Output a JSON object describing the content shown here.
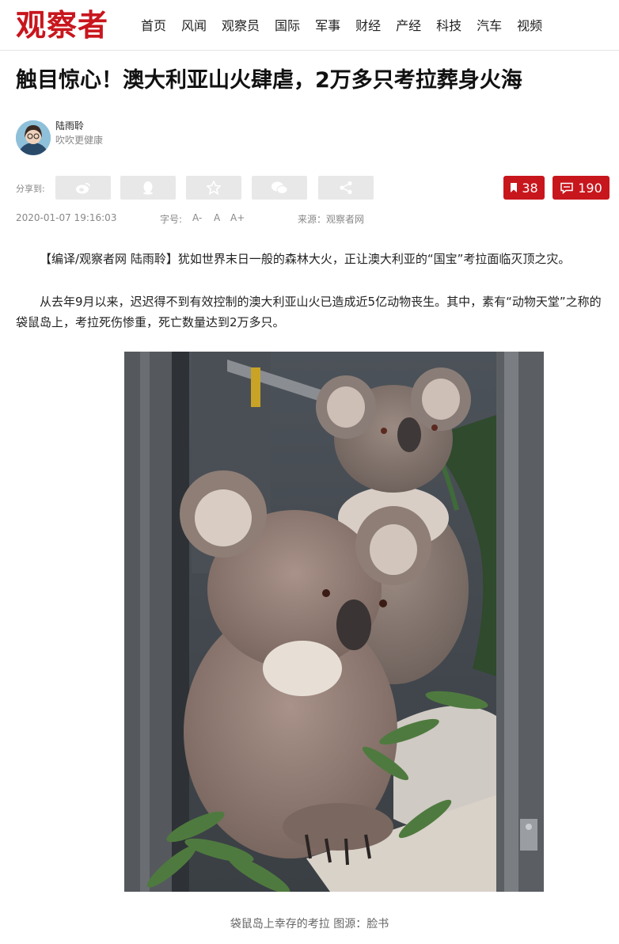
{
  "header": {
    "logo": "观察者",
    "nav": [
      "首页",
      "风闻",
      "观察员",
      "国际",
      "军事",
      "财经",
      "产经",
      "科技",
      "汽车",
      "视频"
    ]
  },
  "article": {
    "title": "触目惊心！澳大利亚山火肆虐，2万多只考拉葬身火海",
    "author": {
      "name": "陆雨聆",
      "motto": "吹吹更健康"
    },
    "share": {
      "label": "分享到:",
      "icons": [
        "weibo-icon",
        "qq-icon",
        "qzone-icon",
        "wechat-icon",
        "share-icon"
      ],
      "bookmarks": "38",
      "comments": "190"
    },
    "meta": {
      "date": "2020-01-07 19:16:03",
      "font_label": "字号:",
      "font_small": "A-",
      "font_normal": "A",
      "font_large": "A+",
      "source": "来源：观察者网"
    },
    "paragraphs": [
      "【编译/观察者网 陆雨聆】犹如世界末日一般的森林大火，正让澳大利亚的“国宝”考拉面临灭顶之灾。",
      "从去年9月以来，迟迟得不到有效控制的澳大利亚山火已造成近5亿动物丧生。其中，素有“动物天堂”之称的袋鼠岛上，考拉死伤惨重，死亡数量达到2万多只。"
    ],
    "photo_caption": "袋鼠岛上幸存的考拉  图源：脸书"
  },
  "colors": {
    "brand": "#c8161d",
    "share_bg": "#e8e8e8"
  }
}
